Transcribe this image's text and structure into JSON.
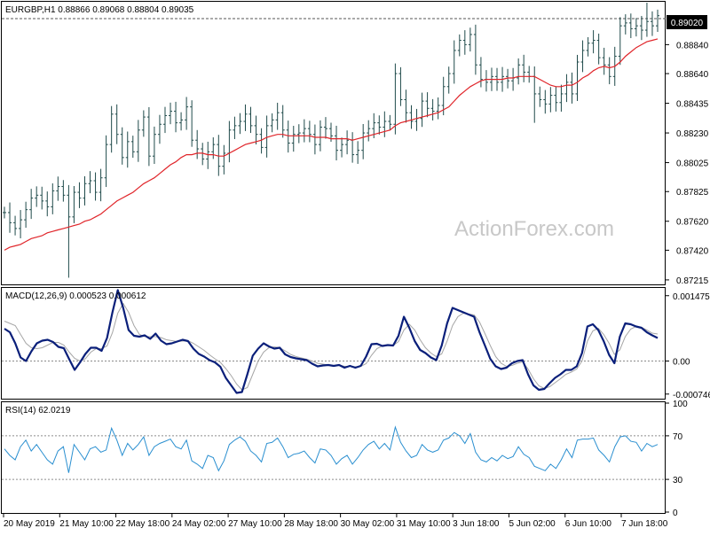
{
  "header": {
    "symbol_line": "EURGBP,H1  0.88866 0.89068 0.88804 0.89035",
    "watermark": "ActionForex.com"
  },
  "colors": {
    "bars": "#1f4a4a",
    "moving_average": "#e0252a",
    "macd_line": "#0a1f7a",
    "macd_signal": "#a6a6a6",
    "rsi": "#2a8fd0",
    "frame": "#000000",
    "dotted": "#8c8c8c",
    "current_price_box": "#000000"
  },
  "chart_data": [
    {
      "type": "line",
      "panel": "price",
      "title": "EURGBP,H1  0.88866 0.89068 0.88804 0.89035",
      "y_ticks": [
        "0.89020",
        "0.88840",
        "0.88640",
        "0.88435",
        "0.88230",
        "0.88025",
        "0.87825",
        "0.87620",
        "0.87420",
        "0.87215"
      ],
      "ylim": [
        0.8719,
        0.8913
      ],
      "current_price_label": "0.89020",
      "current_price": 0.8902,
      "x_ticks": [
        "20 May 2019",
        "21 May 10:00",
        "22 May 18:00",
        "24 May 02:00",
        "27 May 10:00",
        "28 May 18:00",
        "30 May 02:00",
        "31 May 10:00",
        "3 Jun 18:00",
        "5 Jun 02:00",
        "6 Jun 10:00",
        "7 Jun 18:00"
      ],
      "series": [
        {
          "style": "bars",
          "close": [
            0.8768,
            0.8761,
            0.8757,
            0.8763,
            0.877,
            0.8778,
            0.878,
            0.8776,
            0.8772,
            0.8783,
            0.8786,
            0.878,
            0.8765,
            0.8782,
            0.8778,
            0.8788,
            0.879,
            0.8782,
            0.8792,
            0.8815,
            0.8836,
            0.8822,
            0.8806,
            0.8817,
            0.881,
            0.8825,
            0.8834,
            0.8807,
            0.8822,
            0.8829,
            0.8835,
            0.8838,
            0.883,
            0.8832,
            0.8841,
            0.8818,
            0.8812,
            0.8805,
            0.881,
            0.8815,
            0.88,
            0.8809,
            0.8825,
            0.8828,
            0.8831,
            0.8836,
            0.8828,
            0.8822,
            0.8813,
            0.8828,
            0.8832,
            0.8837,
            0.8825,
            0.8816,
            0.8822,
            0.8823,
            0.8826,
            0.8822,
            0.8815,
            0.8827,
            0.8826,
            0.8821,
            0.8811,
            0.8815,
            0.8818,
            0.8808,
            0.8811,
            0.8823,
            0.8826,
            0.883,
            0.8827,
            0.8831,
            0.8829,
            0.8864,
            0.8846,
            0.8837,
            0.8831,
            0.8833,
            0.8845,
            0.884,
            0.8838,
            0.8842,
            0.8855,
            0.8864,
            0.888,
            0.8887,
            0.8884,
            0.8891,
            0.887,
            0.886,
            0.8858,
            0.8862,
            0.8858,
            0.8862,
            0.8859,
            0.8861,
            0.887,
            0.8865,
            0.8862,
            0.885,
            0.8846,
            0.8843,
            0.8849,
            0.8844,
            0.885,
            0.8858,
            0.885,
            0.8872,
            0.888,
            0.8885,
            0.8887,
            0.8875,
            0.887,
            0.8862,
            0.8876,
            0.8897,
            0.8899,
            0.8895,
            0.8897,
            0.8894,
            0.89,
            0.8897,
            0.8904
          ]
        },
        {
          "name": "",
          "style": "moving-average",
          "values": [
            0.8742,
            0.8744,
            0.8745,
            0.8746,
            0.8748,
            0.875,
            0.8751,
            0.8752,
            0.8754,
            0.8755,
            0.8756,
            0.8757,
            0.8758,
            0.8759,
            0.876,
            0.8762,
            0.8763,
            0.8765,
            0.8767,
            0.877,
            0.8773,
            0.8776,
            0.8778,
            0.878,
            0.8782,
            0.8785,
            0.8788,
            0.879,
            0.8792,
            0.8795,
            0.8798,
            0.8801,
            0.8803,
            0.8806,
            0.8808,
            0.8808,
            0.8809,
            0.8809,
            0.8808,
            0.8808,
            0.8807,
            0.8807,
            0.8809,
            0.8811,
            0.8813,
            0.8815,
            0.8816,
            0.8817,
            0.8818,
            0.882,
            0.8821,
            0.8822,
            0.8822,
            0.8821,
            0.8821,
            0.8821,
            0.8821,
            0.8821,
            0.882,
            0.882,
            0.882,
            0.8819,
            0.8819,
            0.8819,
            0.8819,
            0.8818,
            0.8819,
            0.882,
            0.8821,
            0.8822,
            0.8823,
            0.8824,
            0.8825,
            0.8828,
            0.883,
            0.8831,
            0.8832,
            0.8833,
            0.8834,
            0.8835,
            0.8836,
            0.8837,
            0.8839,
            0.8841,
            0.8845,
            0.8849,
            0.8852,
            0.8855,
            0.8857,
            0.8859,
            0.886,
            0.886,
            0.886,
            0.886,
            0.8861,
            0.8861,
            0.8862,
            0.8862,
            0.8862,
            0.8862,
            0.886,
            0.8858,
            0.8856,
            0.8855,
            0.8855,
            0.8856,
            0.8856,
            0.8858,
            0.8861,
            0.8863,
            0.8866,
            0.8868,
            0.8869,
            0.8868,
            0.8869,
            0.8872,
            0.8876,
            0.8879,
            0.8882,
            0.8884,
            0.8886,
            0.8887,
            0.8888
          ]
        }
      ]
    },
    {
      "type": "line",
      "panel": "macd",
      "title": "MACD(12,26,9) 0.000523 0.000612",
      "y_ticks": [
        "0.001475",
        "0.00",
        "-0.000746"
      ],
      "ylim": [
        -0.00083,
        0.00163
      ],
      "series": [
        {
          "name": "",
          "style": "macd",
          "values": [
            0.00073,
            0.00065,
            0.0004,
            8e-05,
            0.0,
            0.00022,
            0.0004,
            0.00046,
            0.00048,
            0.00043,
            0.00032,
            0.00029,
            4e-05,
            -0.0002,
            -3e-05,
            0.00016,
            0.0003,
            0.0003,
            0.00023,
            0.00052,
            0.0011,
            0.0016,
            0.0012,
            0.0007,
            0.00057,
            0.00055,
            0.00058,
            0.0005,
            0.00062,
            0.00046,
            0.00038,
            0.0004,
            0.00044,
            0.00048,
            0.00045,
            0.00028,
            0.00016,
            0.0001,
            2e-05,
            -3e-05,
            -0.00013,
            -0.00038,
            -0.00055,
            -0.00072,
            -0.0007,
            -0.0003,
            0.00012,
            0.00028,
            0.0004,
            0.00033,
            0.00028,
            0.0003,
            0.00015,
            9e-05,
            6e-05,
            4e-05,
            2e-05,
            -6e-05,
            -0.00012,
            -0.0001,
            -9e-05,
            -0.00011,
            -9e-05,
            -0.00015,
            -0.00011,
            -0.00015,
            -0.00011,
            0.0001,
            0.00038,
            0.00039,
            0.00034,
            0.00036,
            0.00035,
            0.00057,
            0.001,
            0.00075,
            0.00045,
            0.00025,
            0.00018,
            8e-05,
            2e-05,
            0.00035,
            0.00085,
            0.0012,
            0.00115,
            0.0011,
            0.00105,
            0.001,
            0.00065,
            0.00035,
            5e-05,
            -0.00012,
            -0.00018,
            -0.00015,
            -5e-05,
            0.0,
            2e-05,
            -0.0003,
            -0.00055,
            -0.00065,
            -0.00063,
            -0.0005,
            -0.00038,
            -0.0003,
            -0.0002,
            -0.0002,
            -0.00012,
            0.00018,
            0.00078,
            0.00083,
            0.0007,
            0.00045,
            0.00014,
            -5e-05,
            0.00055,
            0.00085,
            0.00083,
            0.00078,
            0.00075,
            0.00065,
            0.00058,
            0.00052
          ]
        },
        {
          "name": "",
          "style": "signal",
          "values": [
            0.0009,
            0.00085,
            0.0008,
            0.0006,
            0.0004,
            0.0003,
            0.00028,
            0.0003,
            0.00036,
            0.00042,
            0.00042,
            0.00036,
            0.0002,
            6e-05,
            0.0,
            5e-05,
            0.0002,
            0.00028,
            0.00028,
            0.00034,
            0.00064,
            0.00108,
            0.0013,
            0.0011,
            0.0008,
            0.0006,
            0.00055,
            0.00055,
            0.00055,
            0.00053,
            0.00048,
            0.00046,
            0.00044,
            0.00045,
            0.00046,
            0.0004,
            0.00032,
            0.00024,
            0.00014,
            5e-05,
            -3e-05,
            -0.00017,
            -0.00033,
            -0.00052,
            -0.00065,
            -0.0006,
            -0.0003,
            0.0,
            0.0002,
            0.0003,
            0.00032,
            0.0003,
            0.00023,
            0.00015,
            0.0001,
            7e-05,
            4e-05,
            0.0,
            -5e-05,
            -7e-05,
            -9e-05,
            -0.0001,
            -9e-05,
            -0.00012,
            -0.00012,
            -0.00013,
            -0.00012,
            -6e-05,
            0.00013,
            0.00028,
            0.00034,
            0.00035,
            0.00035,
            0.00044,
            0.0007,
            0.00083,
            0.0007,
            0.00048,
            0.0003,
            0.00018,
            0.0001,
            0.00016,
            0.00045,
            0.0008,
            0.001,
            0.00108,
            0.00106,
            0.00104,
            0.00088,
            0.00062,
            0.00035,
            0.0001,
            -5e-05,
            -0.00012,
            -0.0001,
            -5e-05,
            -2e-05,
            -0.00018,
            -0.0004,
            -0.00056,
            -0.00062,
            -0.00058,
            -0.00049,
            -0.0004,
            -0.0003,
            -0.00025,
            -0.00018,
            0.0,
            0.00045,
            0.00068,
            0.00074,
            0.0006,
            0.0004,
            0.00015,
            0.00025,
            0.00055,
            0.00072,
            0.00078,
            0.00076,
            0.0007,
            0.00063,
            0.00061
          ]
        }
      ]
    },
    {
      "type": "line",
      "panel": "rsi",
      "title": "RSI(14) 62.0219",
      "y_ticks": [
        "100",
        "70",
        "30",
        "0"
      ],
      "ylim": [
        0,
        100
      ],
      "levels": [
        70,
        30
      ],
      "series": [
        {
          "name": "",
          "style": "rsi",
          "values": [
            58,
            52,
            48,
            60,
            66,
            56,
            62,
            55,
            48,
            44,
            56,
            60,
            36,
            62,
            55,
            48,
            58,
            60,
            55,
            57,
            77,
            66,
            52,
            63,
            57,
            62,
            69,
            52,
            60,
            63,
            65,
            67,
            60,
            58,
            66,
            47,
            44,
            40,
            52,
            50,
            38,
            47,
            62,
            66,
            69,
            65,
            56,
            52,
            46,
            63,
            64,
            68,
            60,
            50,
            53,
            54,
            56,
            50,
            45,
            58,
            57,
            52,
            44,
            49,
            52,
            44,
            50,
            57,
            62,
            65,
            58,
            63,
            57,
            78,
            64,
            56,
            50,
            52,
            62,
            57,
            55,
            57,
            66,
            68,
            73,
            70,
            63,
            72,
            55,
            48,
            46,
            50,
            47,
            52,
            49,
            51,
            60,
            53,
            50,
            42,
            40,
            38,
            44,
            40,
            48,
            58,
            50,
            66,
            67,
            67,
            68,
            57,
            52,
            46,
            60,
            69,
            70,
            65,
            64,
            56,
            63,
            60,
            62
          ]
        }
      ]
    }
  ]
}
